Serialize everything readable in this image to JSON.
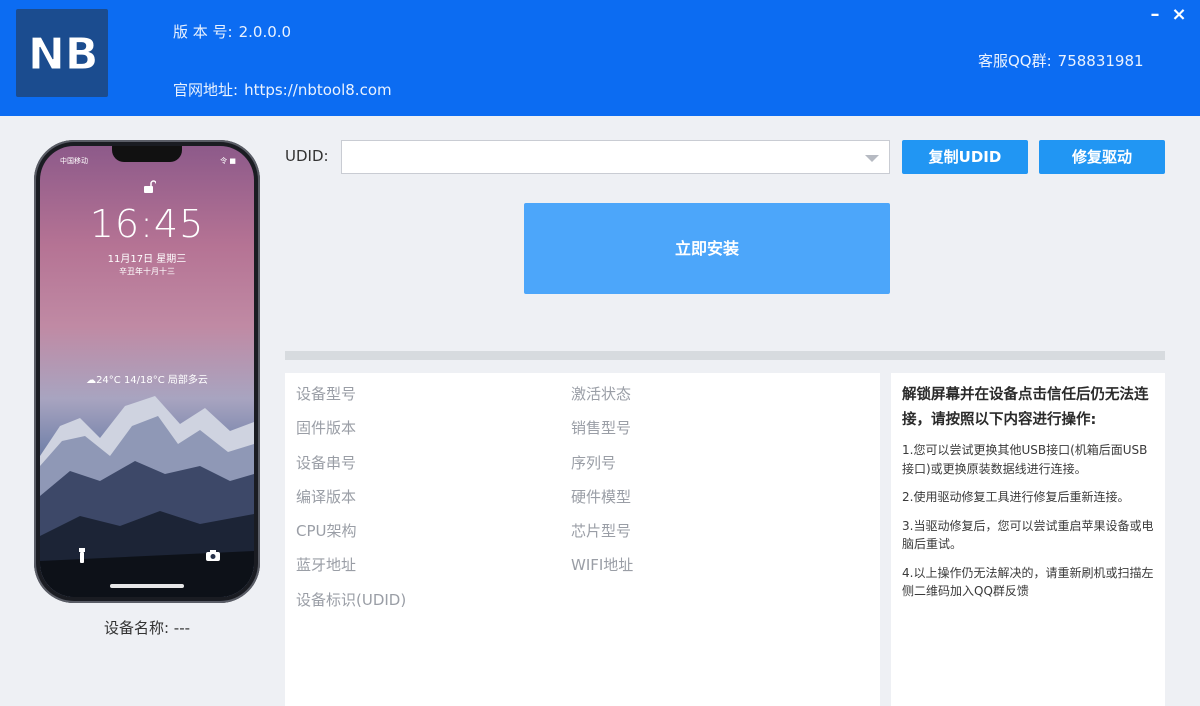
{
  "header": {
    "logo_text": "NB",
    "version_label": "版 本 号:",
    "version_value": "2.0.0.0",
    "site_label": "官网地址:",
    "site_value": "https://nbtool8.com",
    "qq_label": "客服QQ群:",
    "qq_value": "758831981",
    "minimize_glyph": "–",
    "close_glyph": "×"
  },
  "phone": {
    "status_left": "中国移动",
    "status_right": "令 ■",
    "time": "16:45",
    "date": "11月17日 星期三",
    "lunar": "辛丑年十月十三",
    "weather": "☁24°C 14/18°C 局部多云",
    "device_name_label": "设备名称:",
    "device_name_value": "---"
  },
  "udid": {
    "label": "UDID:",
    "value": ""
  },
  "buttons": {
    "copy_udid": "复制UDID",
    "repair_driver": "修复驱动",
    "install": "立即安装"
  },
  "progress": {
    "fraction": 0
  },
  "info": {
    "col1": [
      "设备型号",
      "固件版本",
      "设备串号",
      "编译版本",
      "CPU架构",
      "蓝牙地址",
      "设备标识(UDID)"
    ],
    "col2": [
      "激活状态",
      "销售型号",
      "序列号",
      "硬件模型",
      "芯片型号",
      "WIFI地址"
    ]
  },
  "help": {
    "title": "解锁屏幕并在设备点击信任后仍无法连接，请按照以下内容进行操作:",
    "items": [
      "1.您可以尝试更换其他USB接口(机箱后面USB接口)或更换原装数据线进行连接。",
      "2.使用驱动修复工具进行修复后重新连接。",
      "3.当驱动修复后，您可以尝试重启苹果设备或电脑后重试。",
      "4.以上操作仍无法解决的，请重新刷机或扫描左侧二维码加入QQ群反馈"
    ]
  },
  "colors": {
    "header_bg": "#0c6cf2",
    "button_bg": "#2196f3",
    "install_bg": "#4ca6fa",
    "page_bg": "#eef0f4"
  }
}
